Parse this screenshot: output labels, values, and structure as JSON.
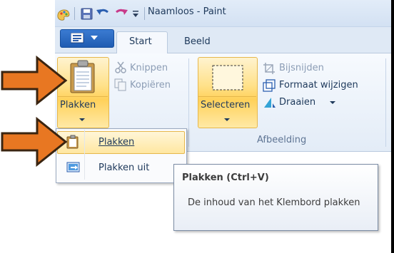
{
  "window": {
    "title": "Naamloos - Paint"
  },
  "tabs": [
    {
      "label": "Start"
    },
    {
      "label": "Beeld"
    }
  ],
  "ribbon": {
    "clipboard": {
      "paste_label": "Plakken",
      "cut_label": "Knippen",
      "copy_label": "Kopiëren"
    },
    "image": {
      "select_label": "Selecteren",
      "crop_label": "Bijsnijden",
      "resize_label": "Formaat wijzigen",
      "rotate_label": "Draaien",
      "group_label": "Afbeelding"
    }
  },
  "dropdown": {
    "items": [
      {
        "label": "Plakken",
        "mnemonic": "P"
      },
      {
        "label": "Plakken uit",
        "mnemonic": "u"
      }
    ]
  },
  "tooltip": {
    "title": "Plakken (Ctrl+V)",
    "body": "De inhoud van het Klembord plakken"
  },
  "colors": {
    "accent_orange": "#e87722",
    "highlight": "#ffd15a",
    "ribbon_text": "#1e395b"
  }
}
